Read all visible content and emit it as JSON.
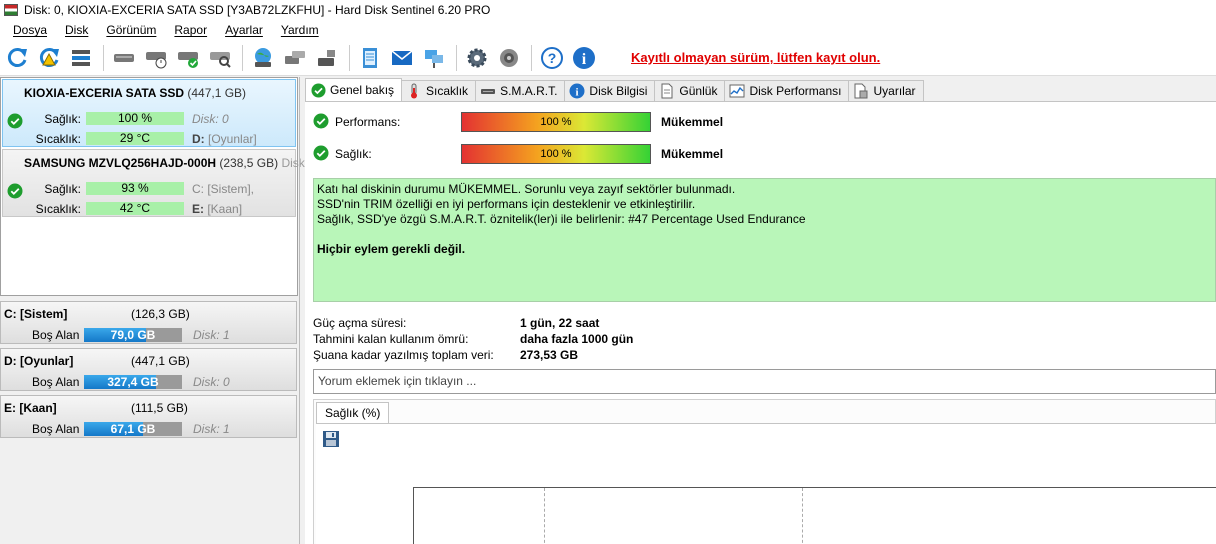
{
  "window": {
    "title": "Disk: 0, KIOXIA-EXCERIA SATA SSD [Y3AB72LZKFHU]  -  Hard Disk Sentinel 6.20 PRO"
  },
  "menu": [
    "Dosya",
    "Disk",
    "Görünüm",
    "Rapor",
    "Ayarlar",
    "Yardım"
  ],
  "toolbar": {
    "icons": [
      "refresh-icon",
      "refresh-warning-icon",
      "disk-list-icon",
      "disk-gray-icon",
      "disk-clock-icon",
      "disk-check-icon",
      "disk-search-icon",
      "globe-disk-icon",
      "disk-transfer-icon",
      "disk-arrow-icon",
      "notepad-icon",
      "mail-icon",
      "network-icon",
      "gear-icon",
      "speaker-icon",
      "help-icon",
      "info-icon"
    ],
    "register_text": "Kayıtlı olmayan sürüm, lütfen kayıt olun."
  },
  "disks": [
    {
      "name": "KIOXIA-EXCERIA SATA SSD",
      "size": "(447,1 GB)",
      "extra": "",
      "health_label": "Sağlık:",
      "health": "100 %",
      "health_extra": "Disk: 0",
      "temp_label": "Sıcaklık:",
      "temp": "29 °C",
      "drive": "D:",
      "drive_label": "[Oyunlar]"
    },
    {
      "name": "SAMSUNG MZVLQ256HAJD-000H",
      "size": "(238,5 GB)",
      "extra": "Disk",
      "health_label": "Sağlık:",
      "health": "93 %",
      "health_extra": "C: [Sistem],",
      "temp_label": "Sıcaklık:",
      "temp": "42 °C",
      "drive": "E:",
      "drive_label": "[Kaan]"
    }
  ],
  "partitions": [
    {
      "name": "C: [Sistem]",
      "size": "(126,3 GB)",
      "free_label": "Boş Alan",
      "free": "79,0 GB",
      "fill": 0.63,
      "disk": "Disk: 1"
    },
    {
      "name": "D: [Oyunlar]",
      "size": "(447,1 GB)",
      "free_label": "Boş Alan",
      "free": "327,4 GB",
      "fill": 0.73,
      "disk": "Disk: 0"
    },
    {
      "name": "E: [Kaan]",
      "size": "(111,5 GB)",
      "free_label": "Boş Alan",
      "free": "67,1 GB",
      "fill": 0.6,
      "disk": "Disk: 1"
    }
  ],
  "tabs": [
    {
      "label": "Genel bakış",
      "icon": "check-circle-icon",
      "active": true
    },
    {
      "label": "Sıcaklık",
      "icon": "thermometer-icon",
      "active": false
    },
    {
      "label": "S.M.A.R.T.",
      "icon": "smart-icon",
      "active": false
    },
    {
      "label": "Disk Bilgisi",
      "icon": "info-icon",
      "active": false
    },
    {
      "label": "Günlük",
      "icon": "log-icon",
      "active": false
    },
    {
      "label": "Disk Performansı",
      "icon": "performance-chart-icon",
      "active": false
    },
    {
      "label": "Uyarılar",
      "icon": "alerts-icon",
      "active": false
    }
  ],
  "overview": {
    "performance": {
      "label": "Performans:",
      "value": "100 %",
      "status": "Mükemmel",
      "level": 1.0
    },
    "health": {
      "label": "Sağlık:",
      "value": "100 %",
      "status": "Mükemmel",
      "level": 1.0
    },
    "status_lines": [
      "Katı hal diskinin durumu MÜKEMMEL. Sorunlu veya zayıf sektörler bulunmadı.",
      "SSD'nin TRIM özelliği en iyi performans için desteklenir ve etkinleştirilir.",
      "Sağlık, SSD'ye özgü S.M.A.R.T. öznitelik(ler)i ile belirlenir:  #47 Percentage Used Endurance"
    ],
    "status_action": "Hiçbir eylem gerekli değil.",
    "info": [
      {
        "label": "Güç açma süresi:",
        "value": "1 gün, 22 saat"
      },
      {
        "label": "Tahmini kalan kullanım ömrü:",
        "value": "daha fazla 1000 gün"
      },
      {
        "label": "Şuana kadar yazılmış toplam veri:",
        "value": "273,53 GB"
      }
    ],
    "comment_placeholder": "Yorum eklemek için tıklayın ...",
    "chart_tab": "Sağlık (%)"
  }
}
